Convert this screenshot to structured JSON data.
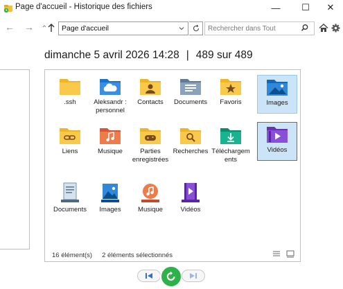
{
  "window": {
    "title": "Page d'accueil - Historique des fichiers",
    "minimize": "—",
    "maximize": "☐",
    "close": "✕"
  },
  "toolbar": {
    "back": "←",
    "forward": "→",
    "address": "Page d'accueil",
    "search_placeholder": "Rechercher dans Tout"
  },
  "header": {
    "date": "dimanche 5 avril 2026 14:28",
    "separator": "|",
    "count": "489 sur 489"
  },
  "items": [
    {
      "label": "Page d'accueil",
      "_": ""
    }
  ],
  "grid": {
    "row1": [
      {
        "label": ".ssh",
        "icon": "folder-icon"
      },
      {
        "label": "Aleksandr : personnel",
        "icon": "onedrive-folder-icon"
      },
      {
        "label": "Contacts",
        "icon": "contacts-folder-icon"
      },
      {
        "label": "Documents",
        "icon": "documents-folder-icon"
      },
      {
        "label": "Favoris",
        "icon": "favorites-folder-icon"
      },
      {
        "label": "Images",
        "icon": "pictures-folder-icon"
      }
    ],
    "row2": [
      {
        "label": "Liens",
        "icon": "links-folder-icon"
      },
      {
        "label": "Musique",
        "icon": "music-folder-icon"
      },
      {
        "label": "Parties enregistrées",
        "icon": "saved-games-folder-icon"
      },
      {
        "label": "Recherches",
        "icon": "searches-folder-icon"
      },
      {
        "label": "Téléchargements",
        "icon": "downloads-folder-icon"
      },
      {
        "label": "Vidéos",
        "icon": "videos-folder-icon"
      }
    ],
    "row3": [
      {
        "label": "Documents",
        "icon": "documents-library-icon"
      },
      {
        "label": "Images",
        "icon": "pictures-library-icon"
      },
      {
        "label": "Musique",
        "icon": "music-library-icon"
      },
      {
        "label": "Vidéos",
        "icon": "videos-library-icon"
      }
    ]
  },
  "status": {
    "count": "16 élément(s)",
    "selected": "2 éléments sélectionnés"
  },
  "colors": {
    "selection": "#cce4f7",
    "folder": "#f8c94a",
    "play": "#2db24a"
  }
}
